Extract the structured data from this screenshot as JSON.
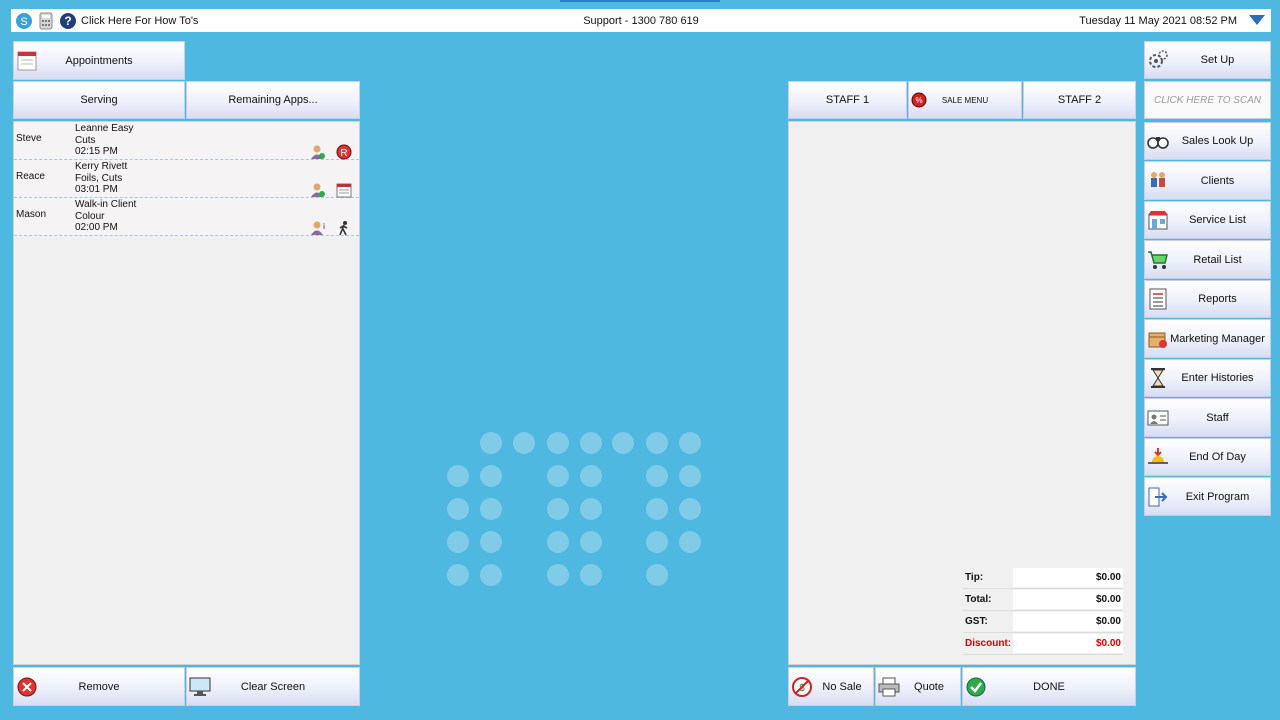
{
  "topbar": {
    "howto": "Click Here For How To's",
    "support": "Support - 1300 780 619",
    "date": "Tuesday 11 May 2021  08:52 PM"
  },
  "left": {
    "appointments": "Appointments",
    "serving": "Serving",
    "remaining": "Remaining Apps...",
    "rows": [
      {
        "staff": "Steve",
        "client": "Leanne Easy",
        "service": "Cuts",
        "time": "02:15 PM",
        "icon1": "client-booked-icon",
        "icon2": "r-badge-icon"
      },
      {
        "staff": "Reace",
        "client": "Kerry Rivett",
        "service": "Foils, Cuts",
        "time": "03:01 PM",
        "icon1": "client-booked-icon",
        "icon2": "calendar-icon"
      },
      {
        "staff": "Mason",
        "client": "Walk-in Client",
        "service": "Colour",
        "time": "02:00 PM",
        "icon1": "client-info-icon",
        "icon2": "walk-in-icon"
      }
    ],
    "remove": "Remove",
    "clear": "Clear Screen"
  },
  "sale": {
    "staff1": "STAFF 1",
    "sale_menu": "SALE MENU",
    "staff2": "STAFF 2",
    "totals": [
      {
        "label": "Tip:",
        "value": "$0.00",
        "red": false
      },
      {
        "label": "Total:",
        "value": "$0.00",
        "red": false
      },
      {
        "label": "GST:",
        "value": "$0.00",
        "red": false
      },
      {
        "label": "Discount:",
        "value": "$0.00",
        "red": true
      }
    ],
    "no_sale": "No Sale",
    "quote": "Quote",
    "done": "DONE"
  },
  "right": {
    "setup": "Set Up",
    "scan": "CLICK HERE TO SCAN",
    "menu": [
      {
        "label": "Sales Look Up",
        "icon": "binoculars-icon"
      },
      {
        "label": "Clients",
        "icon": "clients-icon"
      },
      {
        "label": "Service List",
        "icon": "shop-icon"
      },
      {
        "label": "Retail List",
        "icon": "cart-icon"
      },
      {
        "label": "Reports",
        "icon": "report-icon"
      },
      {
        "label": "Marketing Manager",
        "icon": "marketing-icon"
      },
      {
        "label": "Enter Histories",
        "icon": "hourglass-icon"
      },
      {
        "label": "Staff",
        "icon": "staff-card-icon"
      },
      {
        "label": "End Of Day",
        "icon": "sunset-icon"
      },
      {
        "label": "Exit Program",
        "icon": "exit-icon"
      }
    ]
  },
  "colors": {
    "background": "#4fb8e0",
    "accent": "#2a7fc0",
    "discount": "#d40000"
  }
}
